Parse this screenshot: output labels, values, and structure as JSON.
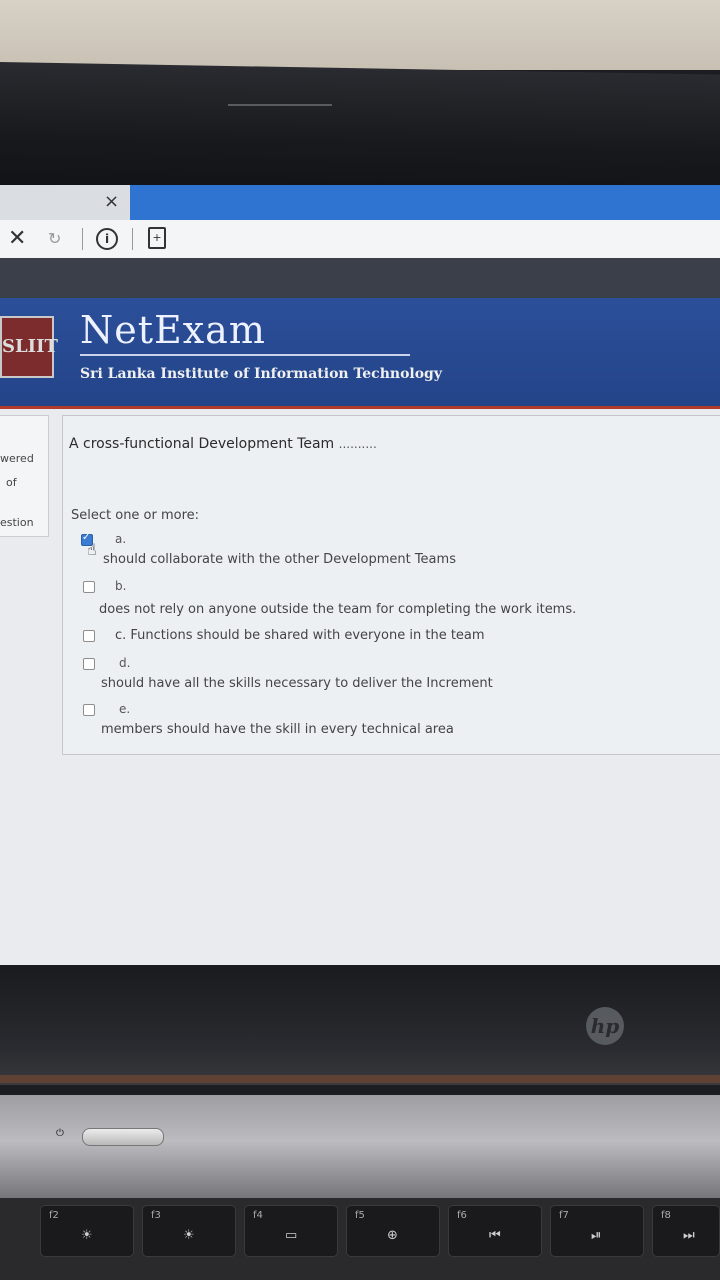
{
  "browser": {
    "tab_close": "×",
    "stop": "✕",
    "reload": "↻",
    "info": "i",
    "page": "+"
  },
  "header": {
    "logo": "SLIIT",
    "brand": "NetExam",
    "institute": "Sri Lanka Institute of Information Technology"
  },
  "sidebar": {
    "line1": "wered",
    "line2": "of",
    "line3": "estion"
  },
  "question": {
    "text": "A cross-functional Development Team",
    "dots": "..........",
    "prompt": "Select one or more:",
    "options": [
      {
        "letter": "a.",
        "text": "should collaborate with the other Development Teams",
        "checked": true
      },
      {
        "letter": "b.",
        "text": "does not rely on anyone outside the team for completing the work items.",
        "checked": false
      },
      {
        "letter": "c.",
        "text": "c. Functions should be shared with everyone in the team",
        "checked": false
      },
      {
        "letter": "d.",
        "text": "should have all the skills necessary to deliver the Increment",
        "checked": false
      },
      {
        "letter": "e.",
        "text": "members should have the skill in every technical area",
        "checked": false
      }
    ]
  },
  "laptop": {
    "brand": "hp",
    "keys": [
      {
        "fn": "f2",
        "glyph": "☀"
      },
      {
        "fn": "f3",
        "glyph": "☀"
      },
      {
        "fn": "f4",
        "glyph": "▭"
      },
      {
        "fn": "f5",
        "glyph": "⊕"
      },
      {
        "fn": "f6",
        "glyph": "⏮"
      },
      {
        "fn": "f7",
        "glyph": "⏯"
      },
      {
        "fn": "f8",
        "glyph": "⏭"
      }
    ]
  }
}
